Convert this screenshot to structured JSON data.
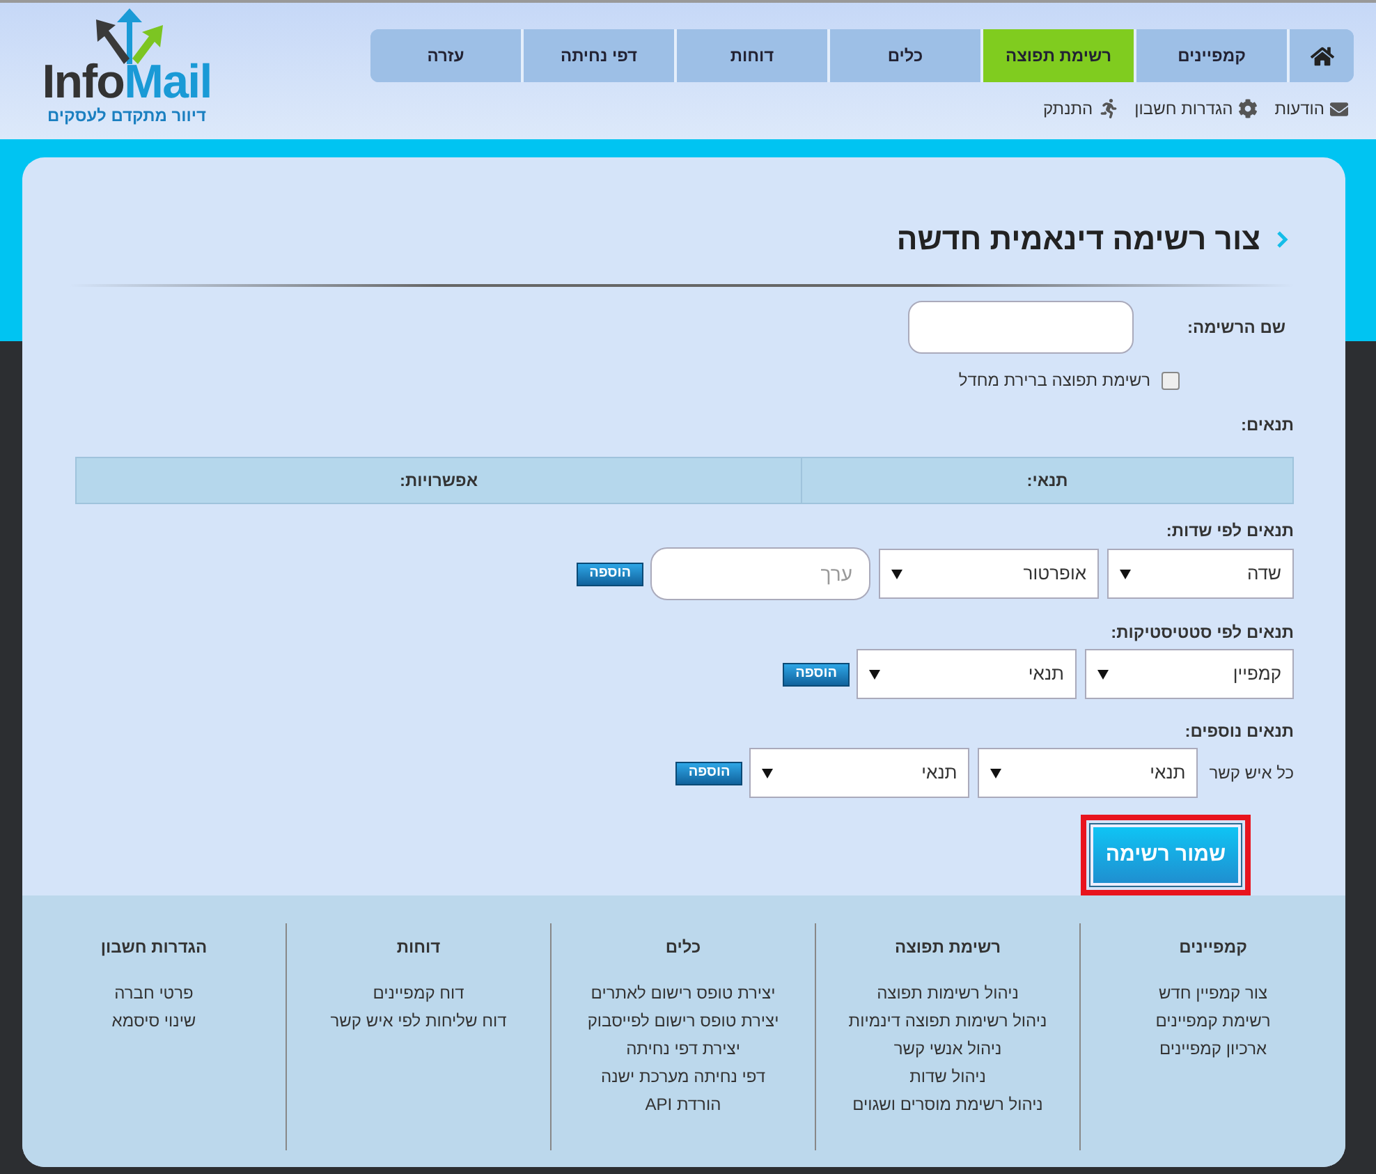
{
  "logo": {
    "part_1": "Info",
    "part_2": "Mail",
    "tagline": "דיוור מתקדם לעסקים"
  },
  "nav_tabs": [
    {
      "kind": "home",
      "selected": false
    },
    {
      "kind": "text",
      "label": "קמפיינים",
      "selected": false
    },
    {
      "kind": "text",
      "label": "רשימת תפוצה",
      "selected": true
    },
    {
      "kind": "text",
      "label": "כלים",
      "selected": false
    },
    {
      "kind": "text",
      "label": "דוחות",
      "selected": false
    },
    {
      "kind": "text",
      "label": "דפי נחיתה",
      "selected": false
    },
    {
      "kind": "text",
      "label": "עזרה",
      "selected": false
    }
  ],
  "user_links": [
    {
      "kind": "messages",
      "label": "הודעות"
    },
    {
      "kind": "settings",
      "label": "הגדרות חשבון"
    },
    {
      "kind": "logout",
      "label": "התנתק"
    }
  ],
  "page_title": "צור רשימה דינאמית חדשה",
  "form": {
    "name_label": "שם הרשימה:",
    "default_list_checkbox": {
      "label": "רשימת תפוצה ברירת מחדל",
      "checked": false
    },
    "conditions_label": "תנאים:",
    "table_columns": [
      "תנאי:",
      "אפשרויות:"
    ],
    "groups": [
      {
        "title": "תנאים לפי שדות:",
        "controls": [
          {
            "kind": "select",
            "value": "שדה"
          },
          {
            "kind": "select",
            "value": "אופרטור"
          },
          {
            "kind": "input",
            "placeholder": "ערך"
          }
        ],
        "button": "הוספה"
      },
      {
        "title": "תנאים לפי סטטיסטיקות:",
        "controls": [
          {
            "kind": "select",
            "value": "קמפיין"
          },
          {
            "kind": "select",
            "value": "תנאי"
          }
        ],
        "button": "הוספה"
      },
      {
        "title": "תנאים נוספים:",
        "prefix": "כל איש קשר",
        "controls": [
          {
            "kind": "select",
            "value": "תנאי"
          },
          {
            "kind": "select",
            "value": "תנאי"
          }
        ],
        "button": "הוספה"
      }
    ],
    "save_button": {
      "label": "שמור רשימה",
      "highlighted": true
    }
  },
  "footer": [
    {
      "title": "קמפיינים",
      "links": [
        "צור קמפיין חדש",
        "רשימת קמפיינים",
        "ארכיון קמפיינים"
      ]
    },
    {
      "title": "רשימת תפוצה",
      "links": [
        "ניהול רשימות תפוצה",
        "ניהול רשימות תפוצה דינמיות",
        "ניהול אנשי קשר",
        "ניהול שדות",
        "ניהול רשימת מוסרים ושגוים"
      ]
    },
    {
      "title": "כלים",
      "links": [
        "יצירת טופס רישום לאתרים",
        "יצירת טופס רישום לפייסבוק",
        "יצירת דפי נחיתה",
        "דפי נחיתה מערכת ישנה",
        "הורדת API"
      ]
    },
    {
      "title": "דוחות",
      "links": [
        "דוח קמפיינים",
        "דוח שליחות לפי איש קשר"
      ]
    },
    {
      "title": "הגדרות חשבון",
      "links": [
        "פרטי חברה",
        "שינוי סיסמא"
      ]
    }
  ]
}
